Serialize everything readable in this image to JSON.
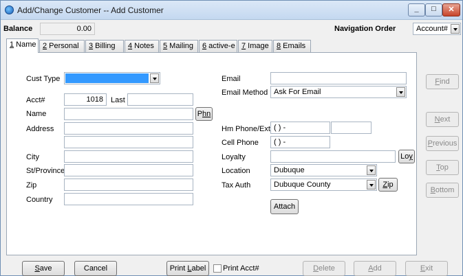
{
  "window": {
    "title": "Add/Change Customer -- Add Customer"
  },
  "header": {
    "balance_label": "Balance",
    "balance_value": "0.00",
    "nav_order_label": "Navigation Order",
    "nav_order_value": "Account#"
  },
  "tabs": [
    {
      "key": "1",
      "rest": " Name"
    },
    {
      "key": "2",
      "rest": " Personal"
    },
    {
      "key": "3",
      "rest": " Billing"
    },
    {
      "key": "4",
      "rest": " Notes"
    },
    {
      "key": "5",
      "rest": " Mailing"
    },
    {
      "key": "6",
      "rest": " active-e"
    },
    {
      "key": "7",
      "rest": " Image"
    },
    {
      "key": "8",
      "rest": " Emails"
    }
  ],
  "form": {
    "cust_type_label": "Cust Type",
    "acct_label": "Acct#",
    "acct_value": "1018",
    "last_label": "Last",
    "name_label": "Name",
    "phn_key": "P",
    "phn_rest": "hn",
    "address_label": "Address",
    "city_label": "City",
    "stprov_label": "St/Province",
    "zip_label": "Zip",
    "country_label": "Country",
    "email_label": "Email",
    "email_method_label": "Email Method",
    "email_method_value": "Ask For Email",
    "hm_phone_label": "Hm Phone/Ext",
    "hm_phone_value": "(  )   -",
    "cell_phone_label": "Cell Phone",
    "cell_phone_value": "(  )   -",
    "loyalty_label": "Loyalty",
    "loy_pre": "Lo",
    "loy_key": "y",
    "location_label": "Location",
    "location_value": "Dubuque",
    "tax_auth_label": "Tax Auth",
    "tax_auth_value": "Dubuque County",
    "zip_btn_key": "Z",
    "zip_btn_rest": "ip",
    "attach_label": "Attach"
  },
  "side_buttons": {
    "find_key": "F",
    "find_rest": "ind",
    "next_key": "N",
    "next_rest": "ext",
    "previous_key": "P",
    "previous_rest": "revious",
    "top_key": "T",
    "top_rest": "op",
    "bottom_key": "B",
    "bottom_rest": "ottom"
  },
  "bottom_bar": {
    "save_key": "S",
    "save_rest": "ave",
    "cancel_label": "Cancel",
    "print_label_pre": "Print ",
    "print_label_key": "L",
    "print_label_rest": "abel",
    "print_acct_label": "Print Acct#",
    "delete_key": "D",
    "delete_rest": "elete",
    "add_key": "A",
    "add_rest": "dd",
    "exit_key": "E",
    "exit_rest": "xit"
  }
}
